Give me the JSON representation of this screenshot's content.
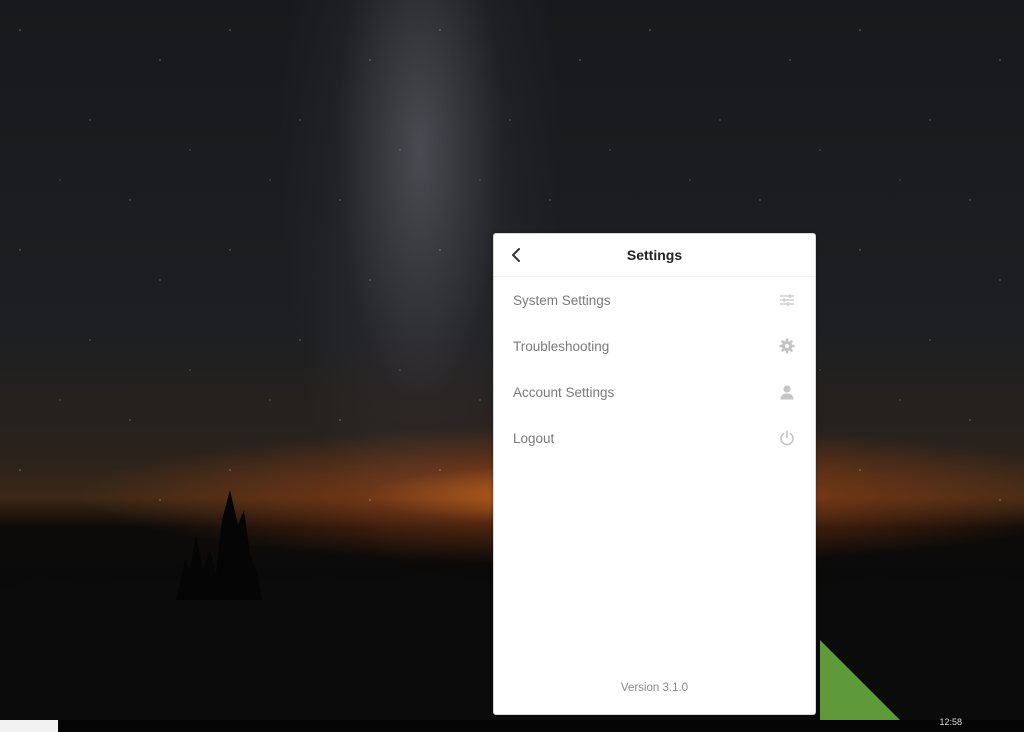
{
  "window": {
    "title": "Settings",
    "back_icon": "chevron-left-icon",
    "version": "Version 3.1.0"
  },
  "menu": {
    "items": [
      {
        "label": "System Settings",
        "icon": "sliders-icon"
      },
      {
        "label": "Troubleshooting",
        "icon": "gear-icon"
      },
      {
        "label": "Account Settings",
        "icon": "user-icon"
      },
      {
        "label": "Logout",
        "icon": "power-icon"
      }
    ]
  },
  "taskbar": {
    "clock": "12:58"
  },
  "colors": {
    "menu_text": "#7a7a7a",
    "icon": "#c4c4c4",
    "title": "#222222",
    "window_bg": "#ffffff"
  }
}
